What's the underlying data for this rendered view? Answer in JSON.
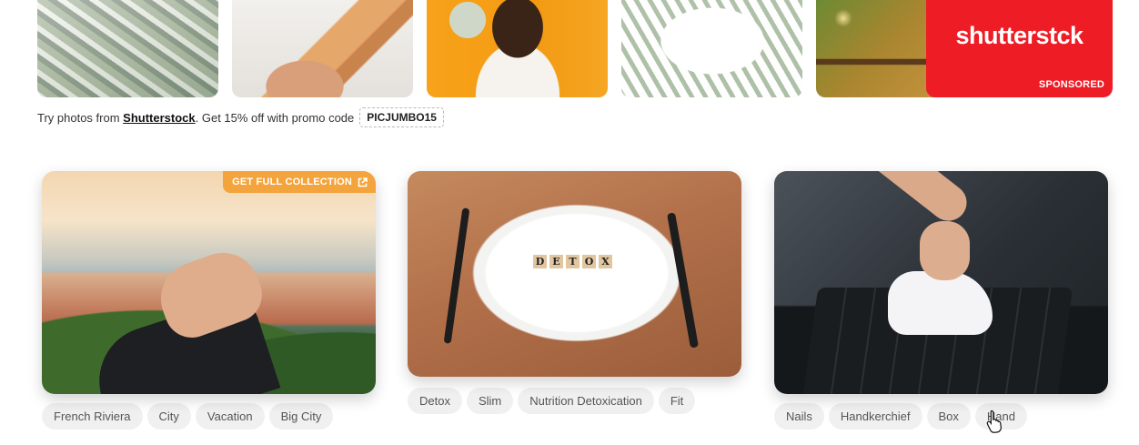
{
  "sponsored": {
    "thumbnails": [
      "money-pile-photo",
      "euro-notes-photo",
      "woman-with-money-photo",
      "flying-dollars-photo",
      "coins-photo"
    ],
    "ad": {
      "logo": "shutterstck",
      "label": "SPONSORED",
      "color": "#ee1c25"
    }
  },
  "promo": {
    "prefix": "Try photos from",
    "brand": "Shutterstock",
    "middle": ". Get 15% off with promo code",
    "code": "PICJUMBO15"
  },
  "cards": [
    {
      "badge": "GET FULL COLLECTION",
      "tags": [
        "French Riviera",
        "City",
        "Vacation",
        "Big City"
      ]
    },
    {
      "tiles": [
        "D",
        "E",
        "T",
        "O",
        "X"
      ],
      "tags": [
        "Detox",
        "Slim",
        "Nutrition Detoxication",
        "Fit"
      ]
    },
    {
      "tags": [
        "Nails",
        "Handkerchief",
        "Box",
        "Hand"
      ]
    }
  ],
  "colors": {
    "badge": "#f4a43c",
    "tag_bg": "#f0f0f0",
    "ad_red": "#ee1c25"
  }
}
